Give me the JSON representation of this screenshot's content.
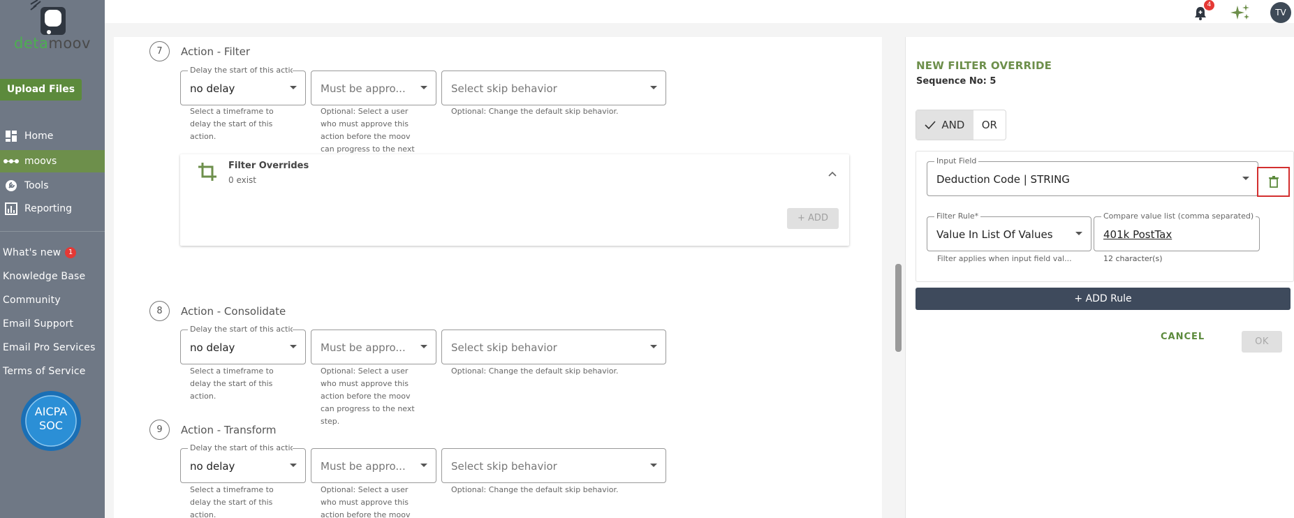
{
  "brand": {
    "logo_text_a": "deta",
    "logo_text_b": "moov"
  },
  "sidebar": {
    "upload_label": "Upload Files",
    "nav": [
      {
        "label": "Home",
        "icon": "home-grid-icon"
      },
      {
        "label": "moovs",
        "icon": "moovs-dots-icon"
      },
      {
        "label": "Tools",
        "icon": "wrench-icon"
      },
      {
        "label": "Reporting",
        "icon": "chart-icon"
      }
    ],
    "links": [
      "What's new",
      "Knowledge Base",
      "Community",
      "Email Support",
      "Email Pro Services",
      "Terms of Service"
    ],
    "whats_new_badge": "1",
    "cert": {
      "line1": "AICPA",
      "line2": "SOC"
    }
  },
  "topbar": {
    "notification_count": "4",
    "avatar_initials": "TV"
  },
  "steps": [
    {
      "number": "7",
      "title": "Action - Filter",
      "delay_label": "Delay the start of this action",
      "delay_value": "no delay",
      "delay_helper": [
        "Select a timeframe to",
        "delay the start of this",
        "action."
      ],
      "approver_placeholder": "Must be appro...",
      "approver_helper": [
        "Optional: Select a user",
        "who must approve this",
        "action before the moov",
        "can progress to the next"
      ],
      "skip_placeholder": "Select skip behavior",
      "skip_helper": "Optional: Change the default skip behavior."
    },
    {
      "number": "8",
      "title": "Action - Consolidate",
      "delay_label": "Delay the start of this action",
      "delay_value": "no delay",
      "delay_helper": [
        "Select a timeframe to",
        "delay the start of this",
        "action."
      ],
      "approver_placeholder": "Must be appro...",
      "approver_helper": [
        "Optional: Select a user",
        "who must approve this",
        "action before the moov",
        "can progress to the next",
        "step."
      ],
      "skip_placeholder": "Select skip behavior",
      "skip_helper": "Optional: Change the default skip behavior."
    },
    {
      "number": "9",
      "title": "Action - Transform",
      "delay_label": "Delay the start of this action",
      "delay_value": "no delay",
      "delay_helper": [
        "Select a timeframe to",
        "delay the start of this",
        "action."
      ],
      "approver_placeholder": "Must be appro...",
      "approver_helper": [
        "Optional: Select a user",
        "who must approve this",
        "action before the moov"
      ],
      "skip_placeholder": "Select skip behavior",
      "skip_helper": "Optional: Change the default skip behavior."
    }
  ],
  "filter_overrides": {
    "title": "Filter Overrides",
    "count": "0 exist",
    "add_label": "+ ADD"
  },
  "panel": {
    "title": "NEW FILTER OVERRIDE",
    "sequence": "Sequence No: 5",
    "and_label": "AND",
    "or_label": "OR",
    "input_field_label": "Input Field",
    "input_field_value": "Deduction Code | STRING",
    "filter_rule_label": "Filter Rule*",
    "filter_rule_value": "Value In List Of Values",
    "filter_rule_helper": "Filter applies when input field val...",
    "compare_label": "Compare value list (comma separated)",
    "compare_value": "401k PostTax",
    "char_count": "12 character(s)",
    "add_rule_label": "+ ADD Rule",
    "cancel_label": "CANCEL",
    "ok_label": "OK"
  },
  "colors": {
    "sidebar_bg": "#6f7885",
    "accent_green": "#6d8f4b",
    "dark_button": "#3e4a5c",
    "alert_red": "#d32f2f"
  }
}
